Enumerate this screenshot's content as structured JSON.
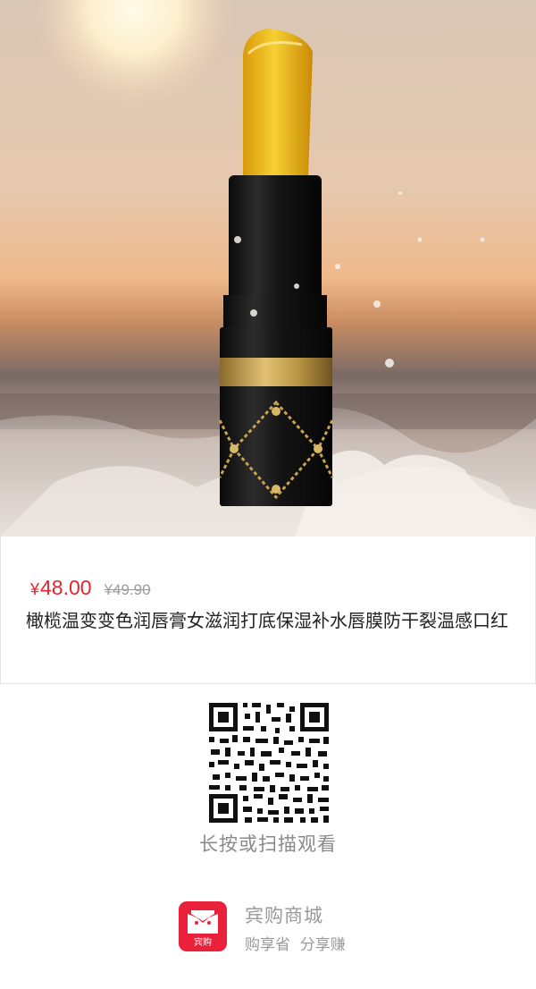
{
  "product": {
    "currency": "¥",
    "price": "48.00",
    "original_price": "¥49.90",
    "title": "橄榄温变变色润唇膏女滋润打底保湿补水唇膜防干裂温感口红"
  },
  "qr": {
    "caption": "长按或扫描观看"
  },
  "brand": {
    "logo_text": "宾购",
    "name": "宾购商城",
    "slogan": "购享省  分享赚"
  },
  "colors": {
    "price_red": "#e8242b",
    "brand_red": "#e9213a",
    "lipstick_yellow": "#f2c21a"
  }
}
